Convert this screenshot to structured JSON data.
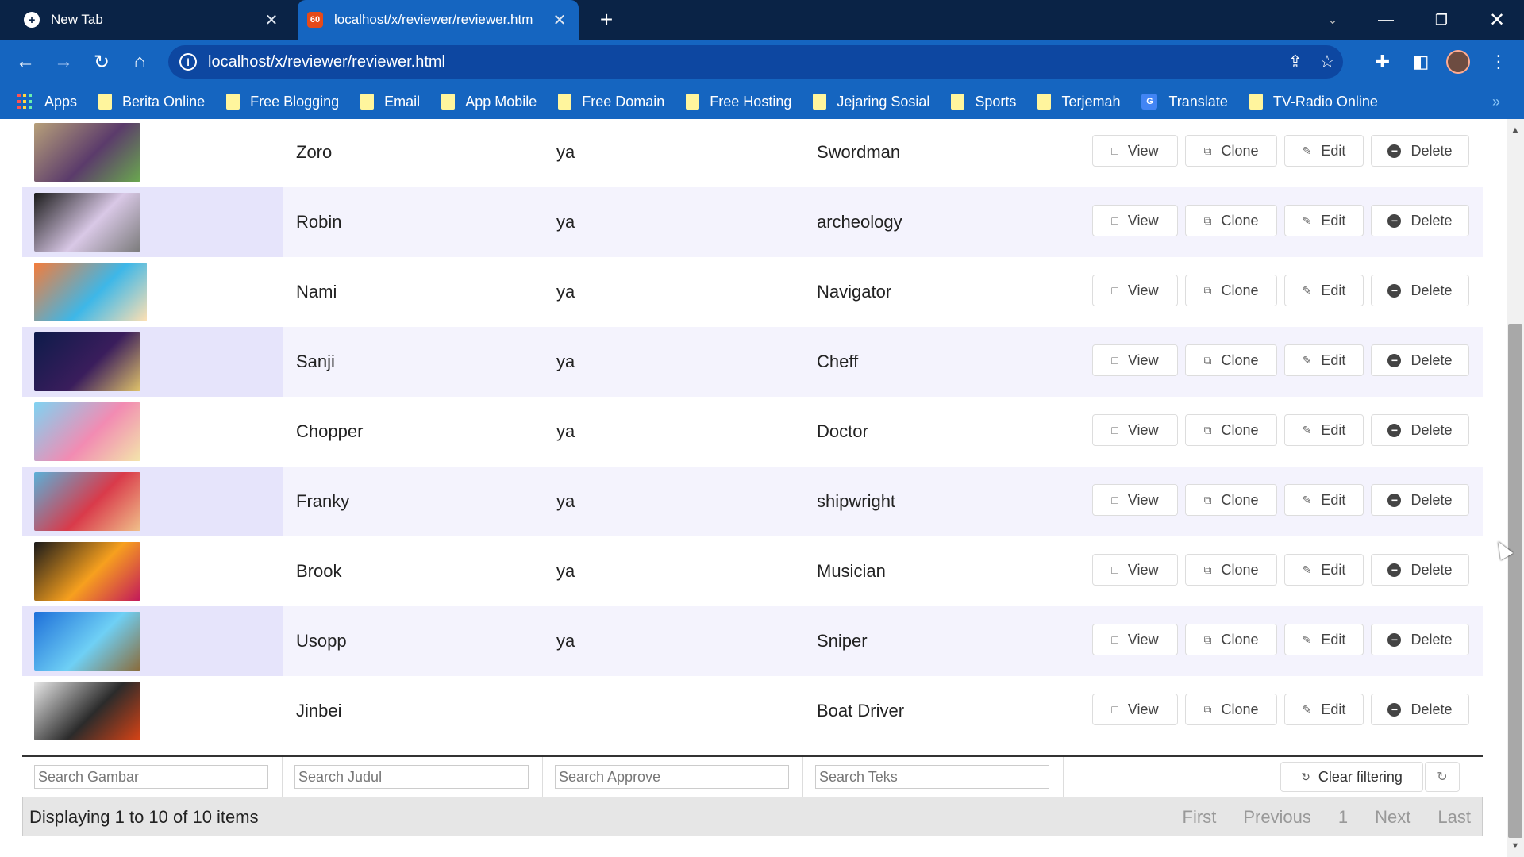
{
  "browser": {
    "tabs": [
      {
        "title": "New Tab",
        "active": false
      },
      {
        "title": "localhost/x/reviewer/reviewer.htm",
        "active": true
      }
    ],
    "url": "localhost/x/reviewer/reviewer.html",
    "bookmarks": [
      {
        "label": "Apps",
        "icon": "apps-grid-icon"
      },
      {
        "label": "Berita Online",
        "icon": "folder-icon"
      },
      {
        "label": "Free Blogging",
        "icon": "folder-icon"
      },
      {
        "label": "Email",
        "icon": "folder-icon"
      },
      {
        "label": "App Mobile",
        "icon": "folder-icon"
      },
      {
        "label": "Free Domain",
        "icon": "folder-icon"
      },
      {
        "label": "Free Hosting",
        "icon": "folder-icon"
      },
      {
        "label": "Jejaring Sosial",
        "icon": "folder-icon"
      },
      {
        "label": "Sports",
        "icon": "folder-icon"
      },
      {
        "label": "Terjemah",
        "icon": "folder-icon"
      },
      {
        "label": "Translate",
        "icon": "google-translate-icon"
      },
      {
        "label": "TV-Radio Online",
        "icon": "folder-icon"
      }
    ],
    "more_bookmarks": "»"
  },
  "grid": {
    "rows": [
      {
        "judul": "Zoro",
        "approve": "ya",
        "teks": "Swordman",
        "thumb_colors": [
          "#b7a07a",
          "#5b3b6b",
          "#6aa84f"
        ]
      },
      {
        "judul": "Robin",
        "approve": "ya",
        "teks": "archeology",
        "thumb_colors": [
          "#1b1b1b",
          "#d9c8e6",
          "#7b7b7b"
        ]
      },
      {
        "judul": "Nami",
        "approve": "ya",
        "teks": "Navigator",
        "thumb_colors": [
          "#f57c3a",
          "#3db7e8",
          "#ffe0b2"
        ]
      },
      {
        "judul": "Sanji",
        "approve": "ya",
        "teks": "Cheff",
        "thumb_colors": [
          "#0d1b4a",
          "#3a1d5c",
          "#e0c36a"
        ]
      },
      {
        "judul": "Chopper",
        "approve": "ya",
        "teks": "Doctor",
        "thumb_colors": [
          "#7fd3f2",
          "#f28bb2",
          "#f3e5ab"
        ]
      },
      {
        "judul": "Franky",
        "approve": "ya",
        "teks": "shipwright",
        "thumb_colors": [
          "#5ab0d8",
          "#d93a4a",
          "#f0c08a"
        ]
      },
      {
        "judul": "Brook",
        "approve": "ya",
        "teks": "Musician",
        "thumb_colors": [
          "#1a1a1a",
          "#f7a01e",
          "#c2185b"
        ]
      },
      {
        "judul": "Usopp",
        "approve": "ya",
        "teks": "Sniper",
        "thumb_colors": [
          "#1e6fd9",
          "#6fd0f5",
          "#8a6b3a"
        ]
      },
      {
        "judul": "Jinbei",
        "approve": "",
        "teks": "Boat Driver",
        "thumb_colors": [
          "#e8e8e8",
          "#2b2b2b",
          "#d84315"
        ]
      }
    ],
    "actions": {
      "view": "View",
      "clone": "Clone",
      "edit": "Edit",
      "delete": "Delete"
    },
    "filters": {
      "gambar": "Search Gambar",
      "judul": "Search Judul",
      "approve": "Search Approve",
      "teks": "Search Teks"
    },
    "clear_filtering": "Clear filtering",
    "display_text": "Displaying 1 to 10 of 10 items",
    "pager": {
      "first": "First",
      "previous": "Previous",
      "page": "1",
      "next": "Next",
      "last": "Last"
    }
  }
}
